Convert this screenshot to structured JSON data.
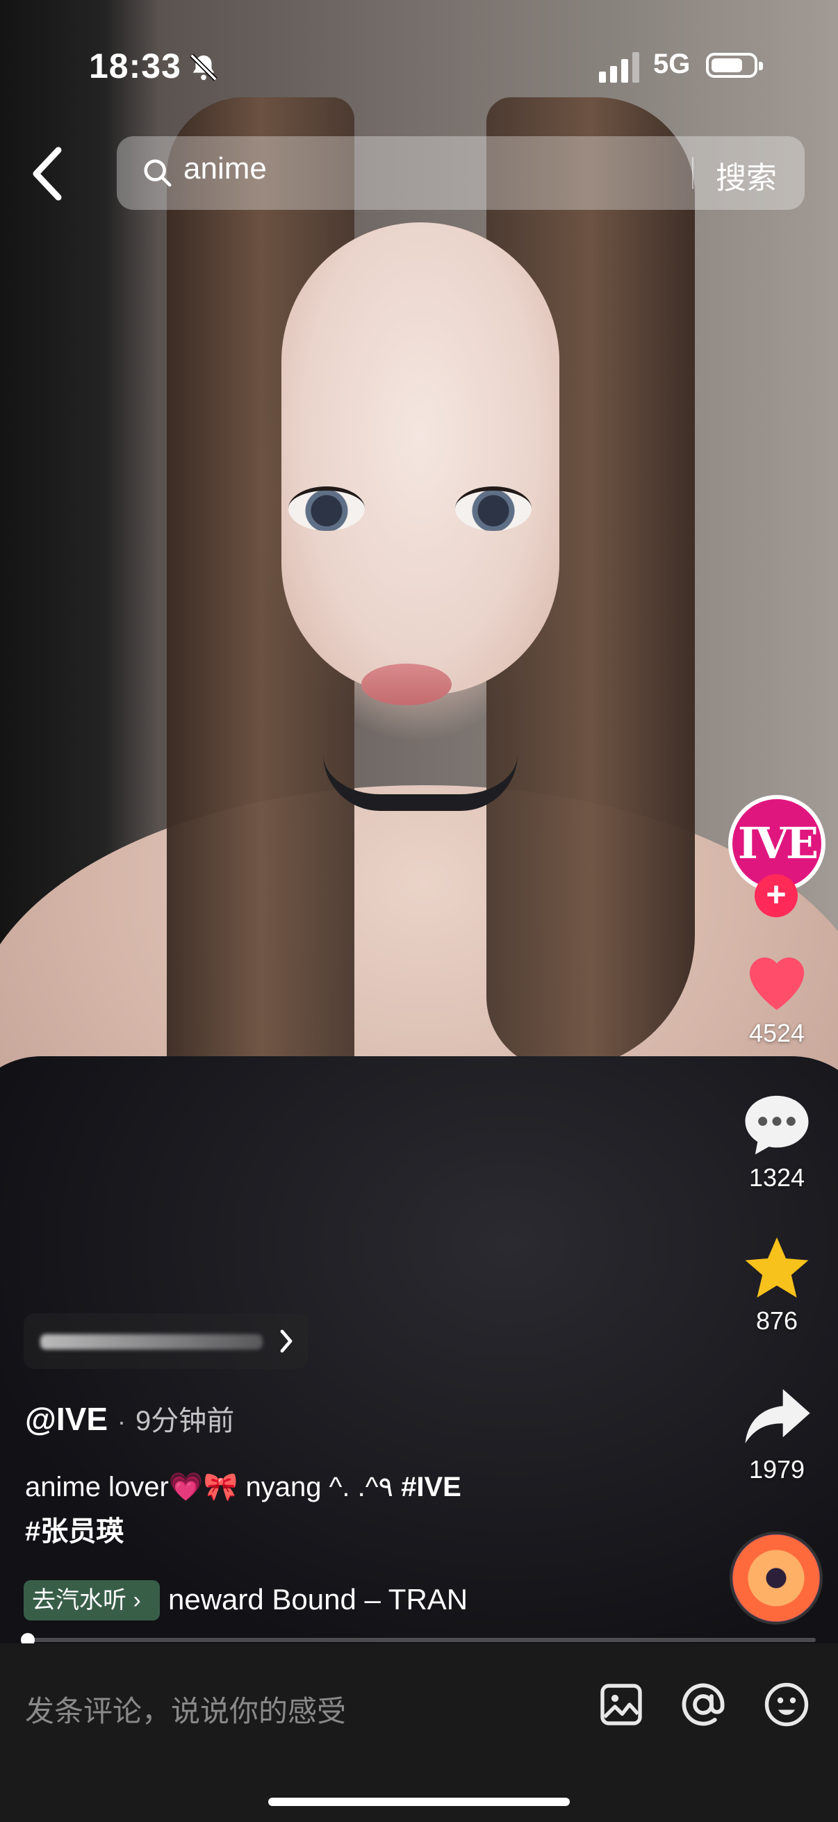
{
  "status_bar": {
    "time": "18:33",
    "network": "5G",
    "battery_level": 0.75
  },
  "search": {
    "query": "anime",
    "button_label": "搜索"
  },
  "creator": {
    "avatar_text": "IVE",
    "follow_label": "+"
  },
  "actions": {
    "likes": "4524",
    "comments": "1324",
    "favorites": "876",
    "shares": "1979"
  },
  "post": {
    "author": "@IVE",
    "time_ago": "9分钟前",
    "caption_text": "anime lover💗🎀 nyang ^. .^٩",
    "hashtags": [
      "#IVE",
      "#张员瑛"
    ]
  },
  "music": {
    "listen_label": "去汽水听",
    "title": "neward Bound – TRAN"
  },
  "playback": {
    "progress": 0.0
  },
  "comment_bar": {
    "placeholder": "发条评论，说说你的感受"
  },
  "icons": {
    "back": "back-icon",
    "search": "search-icon",
    "bell": "silent-bell-icon",
    "like": "heart-icon",
    "comment": "comment-icon",
    "favorite": "star-icon",
    "share": "share-icon",
    "image": "image-icon",
    "mention": "at-icon",
    "emoji": "emoji-icon"
  },
  "colors": {
    "like": "#ff4d6a",
    "favorite": "#f8c21c",
    "follow": "#ff2a57",
    "avatar": "#e0167f"
  }
}
